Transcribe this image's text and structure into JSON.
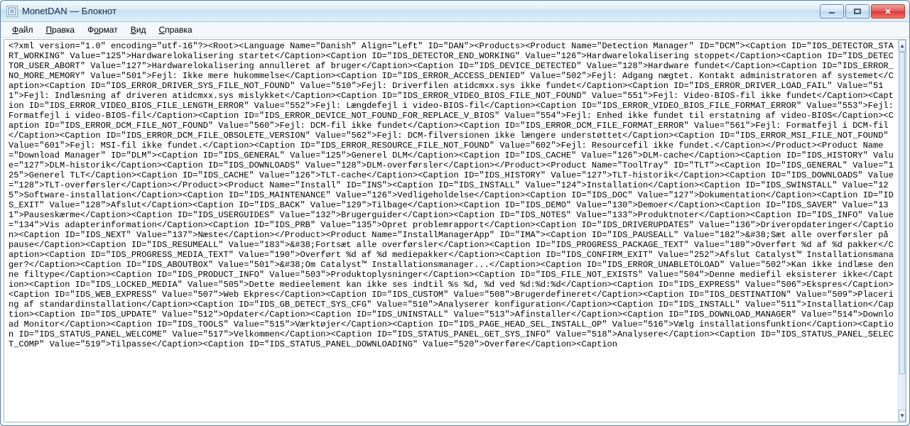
{
  "window": {
    "title": "MonetDAN — Блокнот"
  },
  "menu": {
    "file": {
      "label": "Файл",
      "hotkey": "Ф"
    },
    "edit": {
      "label": "Правка",
      "hotkey": "П"
    },
    "format": {
      "label": "Формат",
      "hotkey": "о"
    },
    "view": {
      "label": "Вид",
      "hotkey": "В"
    },
    "help": {
      "label": "Справка",
      "hotkey": "С"
    }
  },
  "body_text": "<?xml version=\"1.0\" encoding=\"utf-16\"?><Root><Language Name=\"Danish\" Align=\"Left\" ID=\"DAN\"><Products><Product Name=\"Detection Manager\" ID=\"DCM\"><Caption ID=\"IDS_DETECTOR_START_WORKING\" Value=\"125\">Hardwarelokalisering startet</Caption><Caption ID=\"IDS_DETECTOR_END_WORKING\" Value=\"126\">Hardwarelokalisering stoppet</Caption><Caption ID=\"IDS_DETECTOR_USER_ABORT\" Value=\"127\">Hardwarelokalisering annulleret af bruger</Caption><Caption ID=\"IDS_DEVICE_DETECTED\" Value=\"128\">Hardware fundet</Caption><Caption ID=\"IDS_ERROR_NO_MORE_MEMORY\" Value=\"501\">Fejl: Ikke mere hukommelse</Caption><Caption ID=\"IDS_ERROR_ACCESS_DENIED\" Value=\"502\">Fejl: Adgang nægtet. Kontakt administratoren af systemet</Caption><Caption ID=\"IDS_ERROR_DRIVER_SYS_FILE_NOT_FOUND\" Value=\"510\">Fejl: Driverfilen atidcmxx.sys ikke fundet</Caption><Caption ID=\"IDS_ERROR_DRIVER_LOAD_FAIL\" Value=\"511\">Fejl: Indlæsning af driveren atidcmxx.sys mislykket</Caption><Caption ID=\"IDS_ERROR_VIDEO_BIOS_FILE_NOT_FOUND\" Value=\"551\">Fejl: Video-BIOS-fil ikke fundet</Caption><Caption ID=\"IDS_ERROR_VIDEO_BIOS_FILE_LENGTH_ERROR\" Value=\"552\">Fejl: Længdefejl i video-BIOS-fil</Caption><Caption ID=\"IDS_ERROR_VIDEO_BIOS_FILE_FORMAT_ERROR\" Value=\"553\">Fejl: Formatfejl i video-BIOS-fil</Caption><Caption ID=\"IDS_ERROR_DEVICE_NOT_FOUND_FOR_REPLACE_V_BIOS\" Value=\"554\">Fejl: Enhed ikke fundet til erstatning af video-BIOS</Caption><Caption ID=\"IDS_ERROR_DCM_FILE_NOT_FOUND\" Value=\"560\">Fejl: DCM-fil ikke fundet</Caption><Caption ID=\"IDS_ERROR_DCM_FILE_FORMAT_ERROR\" Value=\"561\">Fejl: Formatfejl i DCM-fil</Caption><Caption ID=\"IDS_ERROR_DCM_FILE_OBSOLETE_VERSION\" Value=\"562\">Fejl: DCM-filversionen ikke længere understøttet</Caption><Caption ID=\"IDS_ERROR_MSI_FILE_NOT_FOUND\" Value=\"601\">Fejl: MSI-fil ikke fundet.</Caption><Caption ID=\"IDS_ERROR_RESOURCE_FILE_NOT_FOUND\" Value=\"602\">Fejl: Resourcefil ikke fundet.</Caption></Product><Product Name=\"Download Manager\" ID=\"DLM\"><Caption ID=\"IDS_GENERAL\" Value=\"125\">Generel DLM</Caption><Caption ID=\"IDS_CACHE\" Value=\"126\">DLM-cache</Caption><Caption ID=\"IDS_HISTORY\" Value=\"127\">DLM-historik</Caption><Caption ID=\"IDS_DOWNLOADS\" Value=\"128\">DLM-overførsler</Caption></Product><Product Name=\"ToolTray\" ID=\"TLT\"><Caption ID=\"IDS_GENERAL\" Value=\"125\">Generel TLT</Caption><Caption ID=\"IDS_CACHE\" Value=\"126\">TLT-cache</Caption><Caption ID=\"IDS_HISTORY\" Value=\"127\">TLT-historik</Caption><Caption ID=\"IDS_DOWNLOADS\" Value=\"128\">TLT-overførsler</Caption></Product><Product Name=\"Install\" ID=\"INS\"><Caption ID=\"IDS_INSTALL\" Value=\"124\">Installation</Caption><Caption ID=\"IDS_SWINSTALL\" Value=\"125\">Software-installation</Caption><Caption ID=\"IDS_MAINTENANCE\" Value=\"126\">Vedligeholdelse</Caption><Caption ID=\"IDS_DOC\" Value=\"127\">Dokumentation</Caption><Caption ID=\"IDS_EXIT\" Value=\"128\">Afslut</Caption><Caption ID=\"IDS_BACK\" Value=\"129\">Tilbage</Caption><Caption ID=\"IDS_DEMO\" Value=\"130\">Demoer</Caption><Caption ID=\"IDS_SAVER\" Value=\"131\">Pauseskærme</Caption><Caption ID=\"IDS_USERGUIDES\" Value=\"132\">Brugerguider</Caption><Caption ID=\"IDS_NOTES\" Value=\"133\">Produktnoter</Caption><Caption ID=\"IDS_INFO\" Value=\"134\">Vis adapterinformation</Caption><Caption ID=\"IDS_PRB\" Value=\"135\">Opret problemrapport</Caption><Caption ID=\"IDS_DRIVERUPDATES\" Value=\"136\">Driveropdateringer</Caption><Caption ID=\"IDS_NEXT\" Value=\"137\">Næste</Caption></Product><Product Name=\"InstallManagerApp\" ID=\"IMA\"><Caption ID=\"IDS_PAUSEALL\" Value=\"182\">&#38;Sæt alle overførsler på pause</Caption><Caption ID=\"IDS_RESUMEALL\" Value=\"183\">&#38;Fortsæt alle overførsler</Caption><Caption ID=\"IDS_PROGRESS_PACKAGE_TEXT\" Value=\"189\">Overført %d af %d pakker</Caption><Caption ID=\"IDS_PROGRESS_MEDIA_TEXT\" Value=\"190\">Overført %d af %d mediepakker</Caption><Caption ID=\"IDS_CONFIRM_EXIT\" Value=\"252\">Afslut Catalyst™ Installationsmanager?</Caption><Caption ID=\"IDS_ABOUTBOX\" Value=\"501\">&#38;Om Catalyst™ Installationsmanager...</Caption><Caption ID=\"IDS_ERROR_UNABLETOLOAD\" Value=\"502\">Kan ikke indlæse denne filtype</Caption><Caption ID=\"IDS_PRODUCT_INFO\" Value=\"503\">Produktoplysninger</Caption><Caption ID=\"IDS_FILE_NOT_EXISTS\" Value=\"504\">Denne mediefil eksisterer ikke</Caption><Caption ID=\"IDS_LOCKED_MEDIA\" Value=\"505\">Dette medieelement kan ikke ses indtil %s %d, %d ved %d:%d:%d</Caption><Caption ID=\"IDS_EXPRESS\" Value=\"506\">Ekspres</Caption><Caption ID=\"IDS_WEB_EXPRESS\" Value=\"507\">Web Ekpres</Caption><Caption ID=\"IDS_CUSTOM\" Value=\"508\">Brugerdefineret</Caption><Caption ID=\"IDS_DESTINATION\" Value=\"509\">Placering af standardinstallation</Caption><Caption ID=\"IDS_GB_DETECT_SYS_CFG\" Value=\"510\">Analyserer konfiguration</Caption><Caption ID=\"IDS_INSTALL\" Value=\"511\">Installation</Caption><Caption ID=\"IDS_UPDATE\" Value=\"512\">Opdater</Caption><Caption ID=\"IDS_UNINSTALL\" Value=\"513\">Afinstaller</Caption><Caption ID=\"IDS_DOWNLOAD_MANAGER\" Value=\"514\">Download Monitor</Caption><Caption ID=\"IDS_TOOLS\" Value=\"515\">Værktøjer</Caption><Caption ID=\"IDS_PAGE_HEAD_SEL_INSTALL_OP\" Value=\"516\">Vælg installationsfunktion</Caption><Caption ID=\"IDS_STATUS_PANEL_WELCOME\" Value=\"517\">Velkommen</Caption><Caption ID=\"IDS_STATUS_PANEL_GET_SYS_INFO\" Value=\"518\">Analysere</Caption><Caption ID=\"IDS_STATUS_PANEL_SELECT_COMP\" Value=\"519\">Tilpasse</Caption><Caption ID=\"IDS_STATUS_PANEL_DOWNLOADING\" Value=\"520\">Overføre</Caption><Caption"
}
